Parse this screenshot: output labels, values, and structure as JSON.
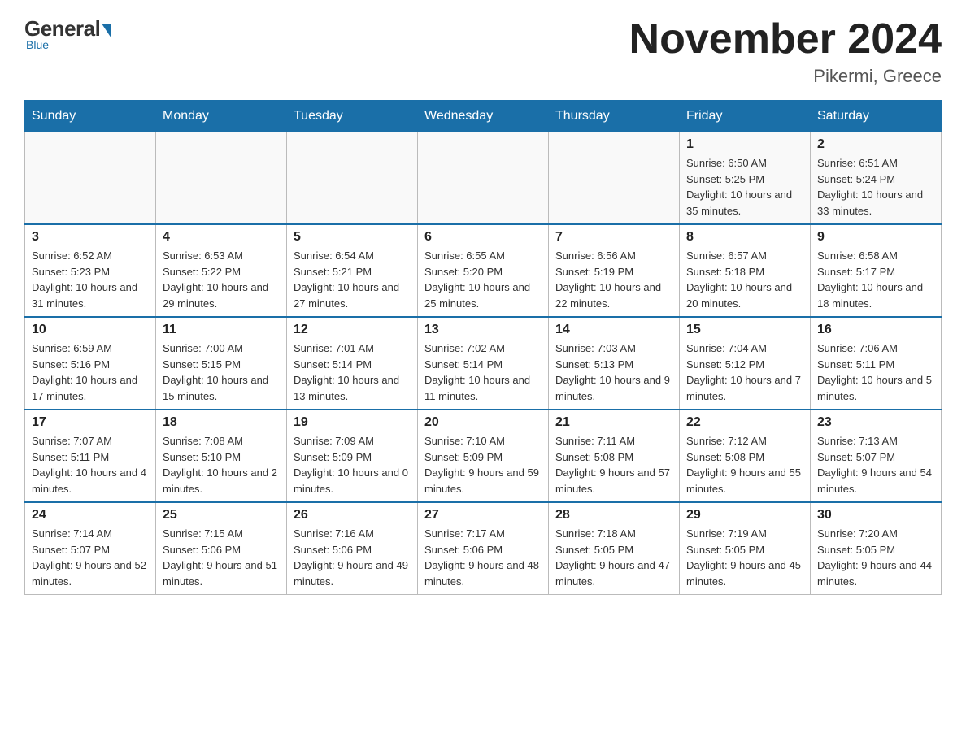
{
  "header": {
    "logo": {
      "general": "General",
      "blue": "Blue",
      "sub": "Blue"
    },
    "title": "November 2024",
    "location": "Pikermi, Greece"
  },
  "calendar": {
    "days_of_week": [
      "Sunday",
      "Monday",
      "Tuesday",
      "Wednesday",
      "Thursday",
      "Friday",
      "Saturday"
    ],
    "weeks": [
      [
        {
          "day": "",
          "info": ""
        },
        {
          "day": "",
          "info": ""
        },
        {
          "day": "",
          "info": ""
        },
        {
          "day": "",
          "info": ""
        },
        {
          "day": "",
          "info": ""
        },
        {
          "day": "1",
          "info": "Sunrise: 6:50 AM\nSunset: 5:25 PM\nDaylight: 10 hours and 35 minutes."
        },
        {
          "day": "2",
          "info": "Sunrise: 6:51 AM\nSunset: 5:24 PM\nDaylight: 10 hours and 33 minutes."
        }
      ],
      [
        {
          "day": "3",
          "info": "Sunrise: 6:52 AM\nSunset: 5:23 PM\nDaylight: 10 hours and 31 minutes."
        },
        {
          "day": "4",
          "info": "Sunrise: 6:53 AM\nSunset: 5:22 PM\nDaylight: 10 hours and 29 minutes."
        },
        {
          "day": "5",
          "info": "Sunrise: 6:54 AM\nSunset: 5:21 PM\nDaylight: 10 hours and 27 minutes."
        },
        {
          "day": "6",
          "info": "Sunrise: 6:55 AM\nSunset: 5:20 PM\nDaylight: 10 hours and 25 minutes."
        },
        {
          "day": "7",
          "info": "Sunrise: 6:56 AM\nSunset: 5:19 PM\nDaylight: 10 hours and 22 minutes."
        },
        {
          "day": "8",
          "info": "Sunrise: 6:57 AM\nSunset: 5:18 PM\nDaylight: 10 hours and 20 minutes."
        },
        {
          "day": "9",
          "info": "Sunrise: 6:58 AM\nSunset: 5:17 PM\nDaylight: 10 hours and 18 minutes."
        }
      ],
      [
        {
          "day": "10",
          "info": "Sunrise: 6:59 AM\nSunset: 5:16 PM\nDaylight: 10 hours and 17 minutes."
        },
        {
          "day": "11",
          "info": "Sunrise: 7:00 AM\nSunset: 5:15 PM\nDaylight: 10 hours and 15 minutes."
        },
        {
          "day": "12",
          "info": "Sunrise: 7:01 AM\nSunset: 5:14 PM\nDaylight: 10 hours and 13 minutes."
        },
        {
          "day": "13",
          "info": "Sunrise: 7:02 AM\nSunset: 5:14 PM\nDaylight: 10 hours and 11 minutes."
        },
        {
          "day": "14",
          "info": "Sunrise: 7:03 AM\nSunset: 5:13 PM\nDaylight: 10 hours and 9 minutes."
        },
        {
          "day": "15",
          "info": "Sunrise: 7:04 AM\nSunset: 5:12 PM\nDaylight: 10 hours and 7 minutes."
        },
        {
          "day": "16",
          "info": "Sunrise: 7:06 AM\nSunset: 5:11 PM\nDaylight: 10 hours and 5 minutes."
        }
      ],
      [
        {
          "day": "17",
          "info": "Sunrise: 7:07 AM\nSunset: 5:11 PM\nDaylight: 10 hours and 4 minutes."
        },
        {
          "day": "18",
          "info": "Sunrise: 7:08 AM\nSunset: 5:10 PM\nDaylight: 10 hours and 2 minutes."
        },
        {
          "day": "19",
          "info": "Sunrise: 7:09 AM\nSunset: 5:09 PM\nDaylight: 10 hours and 0 minutes."
        },
        {
          "day": "20",
          "info": "Sunrise: 7:10 AM\nSunset: 5:09 PM\nDaylight: 9 hours and 59 minutes."
        },
        {
          "day": "21",
          "info": "Sunrise: 7:11 AM\nSunset: 5:08 PM\nDaylight: 9 hours and 57 minutes."
        },
        {
          "day": "22",
          "info": "Sunrise: 7:12 AM\nSunset: 5:08 PM\nDaylight: 9 hours and 55 minutes."
        },
        {
          "day": "23",
          "info": "Sunrise: 7:13 AM\nSunset: 5:07 PM\nDaylight: 9 hours and 54 minutes."
        }
      ],
      [
        {
          "day": "24",
          "info": "Sunrise: 7:14 AM\nSunset: 5:07 PM\nDaylight: 9 hours and 52 minutes."
        },
        {
          "day": "25",
          "info": "Sunrise: 7:15 AM\nSunset: 5:06 PM\nDaylight: 9 hours and 51 minutes."
        },
        {
          "day": "26",
          "info": "Sunrise: 7:16 AM\nSunset: 5:06 PM\nDaylight: 9 hours and 49 minutes."
        },
        {
          "day": "27",
          "info": "Sunrise: 7:17 AM\nSunset: 5:06 PM\nDaylight: 9 hours and 48 minutes."
        },
        {
          "day": "28",
          "info": "Sunrise: 7:18 AM\nSunset: 5:05 PM\nDaylight: 9 hours and 47 minutes."
        },
        {
          "day": "29",
          "info": "Sunrise: 7:19 AM\nSunset: 5:05 PM\nDaylight: 9 hours and 45 minutes."
        },
        {
          "day": "30",
          "info": "Sunrise: 7:20 AM\nSunset: 5:05 PM\nDaylight: 9 hours and 44 minutes."
        }
      ]
    ]
  }
}
